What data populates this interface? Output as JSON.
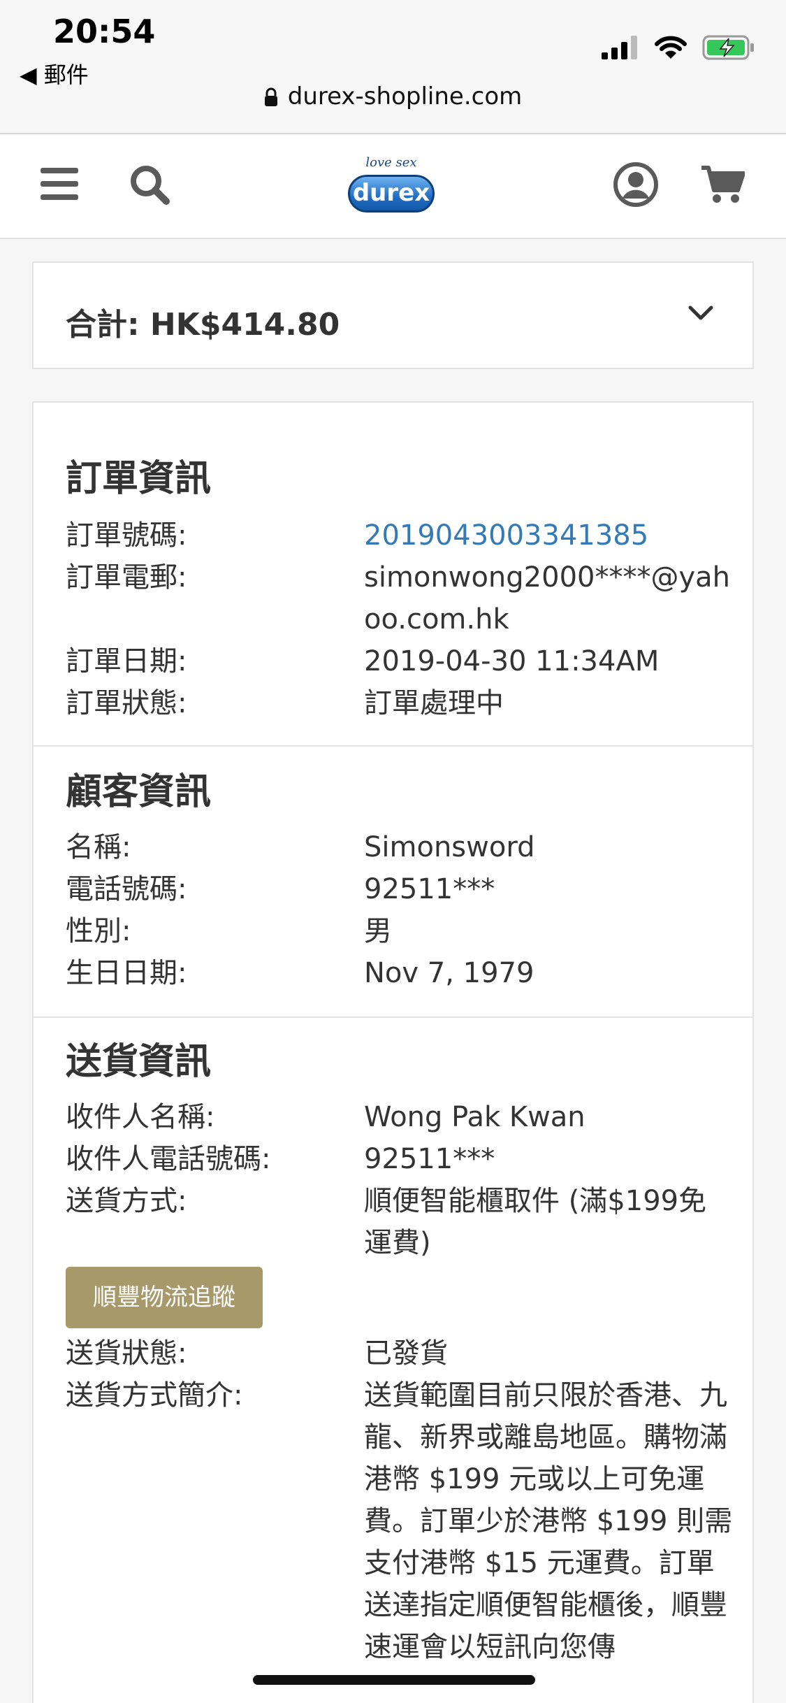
{
  "status": {
    "time": "20:54",
    "back_label": "◀ 郵件",
    "url": "durex-shopline.com"
  },
  "header": {
    "logo_tagline": "love sex",
    "logo_brand": "durex"
  },
  "summary": {
    "total_label": "合計: HK$414.80"
  },
  "order_info": {
    "title": "訂單資訊",
    "rows": [
      {
        "label": "訂單號碼:",
        "value": "2019043003341385"
      },
      {
        "label": "訂單電郵:",
        "value": "simonwong2000****@yahoo.com.hk"
      },
      {
        "label": "訂單日期:",
        "value": "2019-04-30 11:34AM"
      },
      {
        "label": "訂單狀態:",
        "value": "訂單處理中"
      }
    ]
  },
  "customer_info": {
    "title": "顧客資訊",
    "rows": [
      {
        "label": "名稱:",
        "value": "Simonsword"
      },
      {
        "label": "電話號碼:",
        "value": "92511***"
      },
      {
        "label": "性別:",
        "value": "男"
      },
      {
        "label": "生日日期:",
        "value": "Nov 7, 1979"
      }
    ]
  },
  "delivery_info": {
    "title": "送貨資訊",
    "rows": [
      {
        "label": "收件人名稱:",
        "value": "Wong Pak Kwan"
      },
      {
        "label": "收件人電話號碼:",
        "value": "92511***"
      },
      {
        "label": "送貨方式:",
        "value": "順便智能櫃取件 (滿$199免運費)"
      }
    ],
    "track_button": "順豐物流追蹤",
    "status_label": "送貨狀態:",
    "status_value": "已發貨",
    "desc_label": "送貨方式簡介:",
    "desc_value": "送貨範圍目前只限於香港、九龍、新界或離島地區。購物滿港幣 $199 元或以上可免運費。訂單少於港幣 $199 則需支付港幣 $15 元運費。訂單送達指定順便智能櫃後，順豐速運會以短訊向您傳"
  },
  "colors": {
    "link": "#337ab7",
    "button": "#a8996a",
    "battery": "#35c759"
  }
}
